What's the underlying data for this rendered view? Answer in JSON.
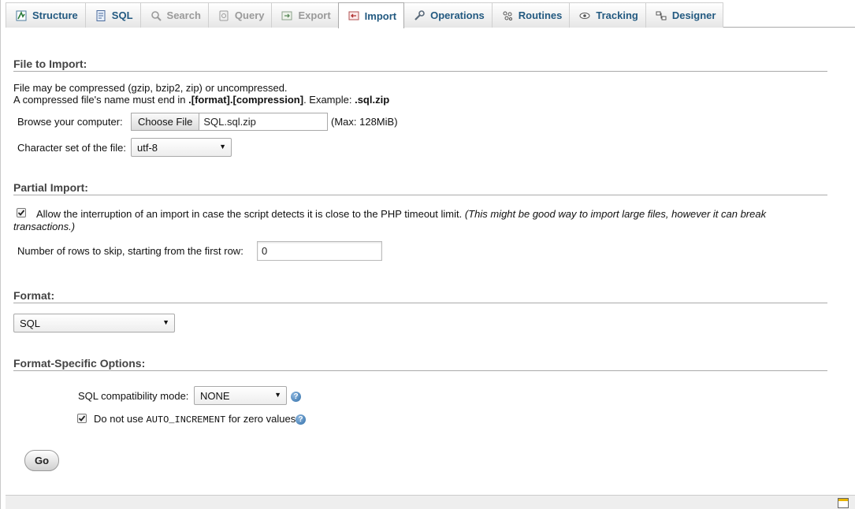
{
  "tabs": [
    {
      "label": "Structure",
      "icon": "structure-icon",
      "state": "normal"
    },
    {
      "label": "SQL",
      "icon": "sql-icon",
      "state": "normal"
    },
    {
      "label": "Search",
      "icon": "search-icon",
      "state": "disabled"
    },
    {
      "label": "Query",
      "icon": "query-icon",
      "state": "disabled"
    },
    {
      "label": "Export",
      "icon": "export-icon",
      "state": "disabled"
    },
    {
      "label": "Import",
      "icon": "import-icon",
      "state": "active"
    },
    {
      "label": "Operations",
      "icon": "wrench-icon",
      "state": "normal"
    },
    {
      "label": "Routines",
      "icon": "routines-icon",
      "state": "normal"
    },
    {
      "label": "Tracking",
      "icon": "eye-icon",
      "state": "normal"
    },
    {
      "label": "Designer",
      "icon": "designer-icon",
      "state": "normal"
    }
  ],
  "file_import": {
    "title": "File to Import:",
    "note1": "File may be compressed (gzip, bzip2, zip) or uncompressed.",
    "note2_pre": "A compressed file's name must end in ",
    "note2_bold": ".[format].[compression]",
    "note2_mid": ". Example: ",
    "note2_example": ".sql.zip",
    "browse_label": "Browse your computer:",
    "choose_button": "Choose File",
    "file_name": "SQL.sql.zip",
    "max_size": "(Max: 128MiB)",
    "charset_label": "Character set of the file:",
    "charset_value": "utf-8"
  },
  "partial_import": {
    "title": "Partial Import:",
    "allow_interrupt_checked": true,
    "allow_interrupt_text": "Allow the interruption of an import in case the script detects it is close to the PHP timeout limit.",
    "allow_interrupt_note_a": "(This might be good way to import large files, however it can break",
    "allow_interrupt_note_b": "transactions.)",
    "skip_rows_label": "Number of rows to skip, starting from the first row:",
    "skip_rows_value": "0"
  },
  "format": {
    "title": "Format:",
    "value": "SQL"
  },
  "format_options": {
    "title": "Format-Specific Options:",
    "compat_label": "SQL compatibility mode:",
    "compat_value": "NONE",
    "auto_inc_checked": true,
    "auto_inc_pre": "Do not use",
    "auto_inc_code": "AUTO_INCREMENT",
    "auto_inc_post": "for zero values",
    "help_glyph": "?"
  },
  "actions": {
    "go_label": "Go"
  },
  "colors": {
    "tab_text": "#235a81",
    "disabled_text": "#9a9a9a",
    "rule": "#aaaaaa"
  }
}
